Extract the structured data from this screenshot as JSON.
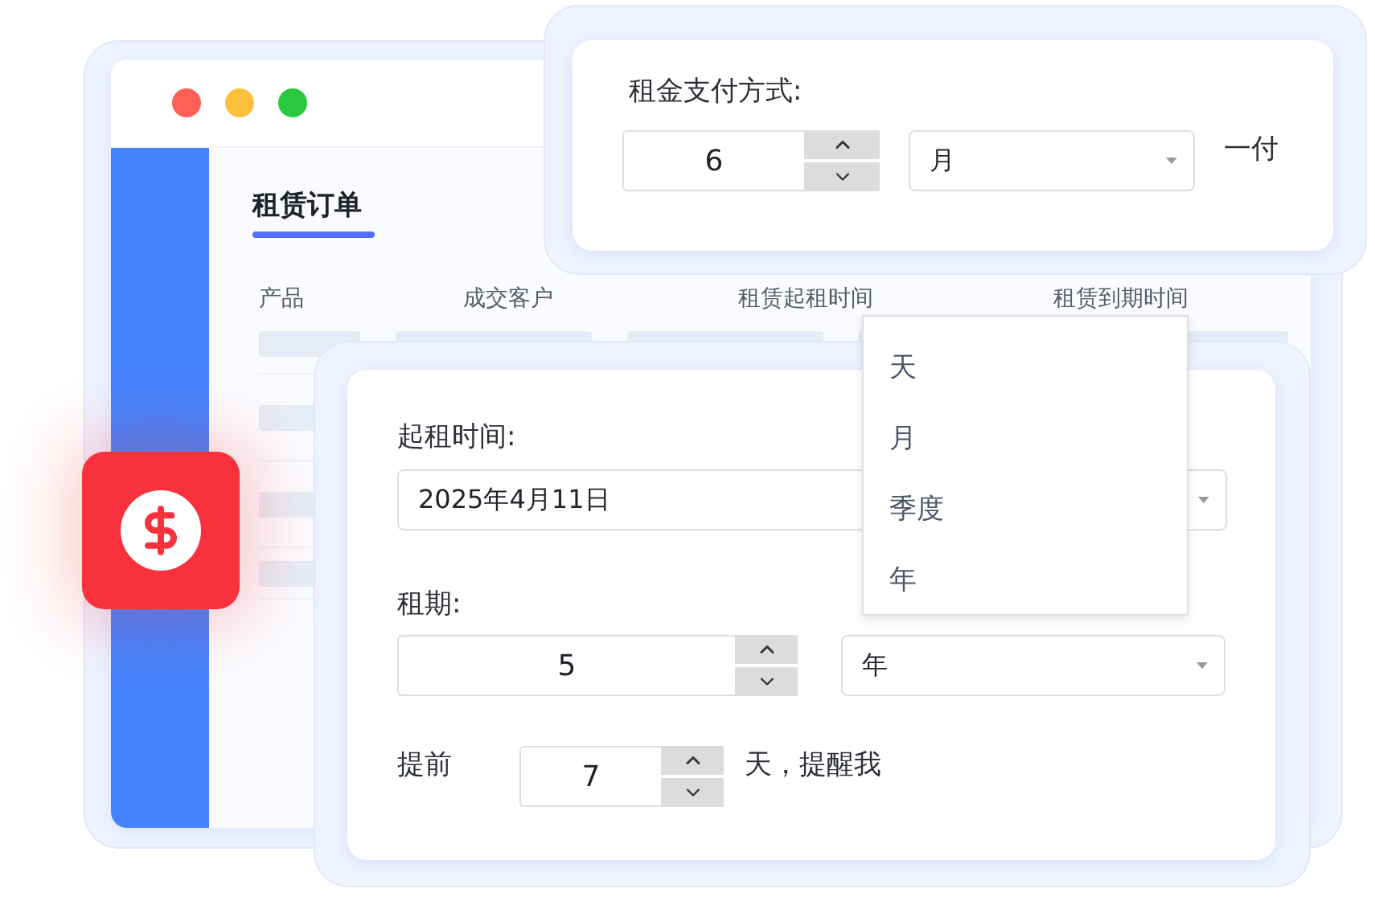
{
  "order_window": {
    "title": "租赁订单",
    "columns": [
      "产品",
      "成交客户",
      "租赁起租时间",
      "租赁到期时间"
    ]
  },
  "payment_card": {
    "label": "租金支付方式:",
    "count": "6",
    "unit": "月",
    "suffix": "一付"
  },
  "unit_menu": {
    "items": [
      "天",
      "月",
      "季度",
      "年"
    ]
  },
  "lease_card": {
    "start_label": "起租时间:",
    "start_date": "2025年4月11日",
    "term_label": "租期:",
    "term_count": "5",
    "term_unit": "年",
    "remind_prefix": "提前",
    "remind_days": "7",
    "remind_suffix": "天，提醒我"
  }
}
